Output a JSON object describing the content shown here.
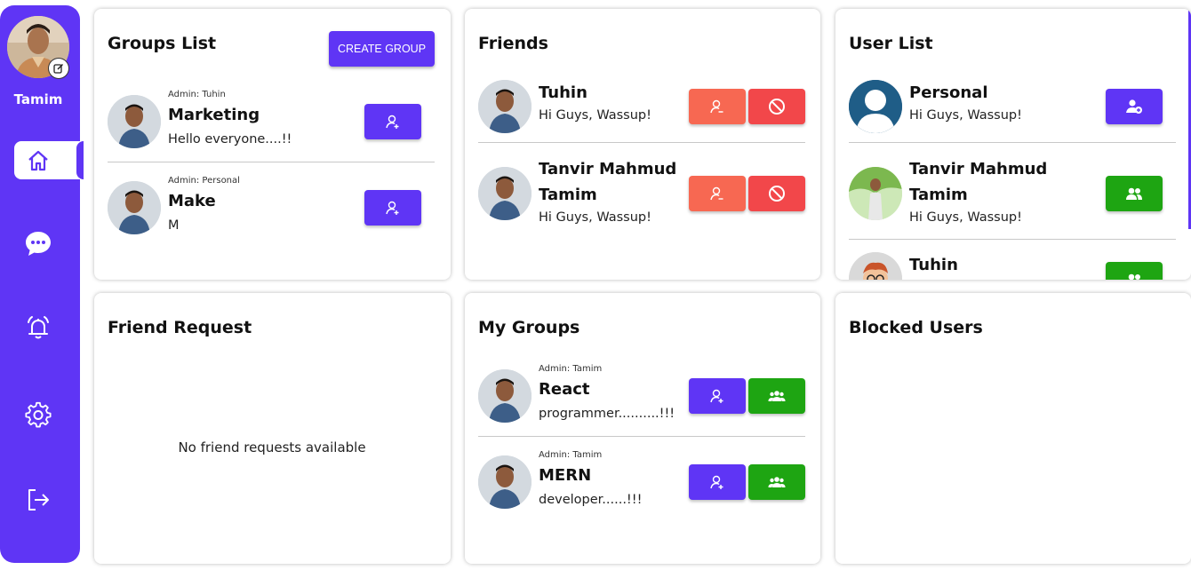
{
  "profile": {
    "name": "Tamim"
  },
  "nav": [
    {
      "icon": "home-icon"
    },
    {
      "icon": "chat-icon"
    },
    {
      "icon": "bell-icon"
    },
    {
      "icon": "gear-icon"
    },
    {
      "icon": "logout-icon"
    }
  ],
  "groups_list": {
    "title": "Groups List",
    "create_label": "CREATE GROUP",
    "items": [
      {
        "admin": "Admin: Tuhin",
        "name": "Marketing",
        "msg": "Hello everyone....!!"
      },
      {
        "admin": "Admin: Personal",
        "name": "Make",
        "msg": "M"
      }
    ]
  },
  "friends": {
    "title": "Friends",
    "items": [
      {
        "name": "Tuhin",
        "msg": "Hi Guys, Wassup!"
      },
      {
        "name_line1": "Tanvir Mahmud",
        "name_line2": "Tamim",
        "msg": "Hi Guys, Wassup!"
      }
    ]
  },
  "user_list": {
    "title": "User List",
    "items": [
      {
        "name": "Personal",
        "msg": "Hi Guys, Wassup!"
      },
      {
        "name_line1": "Tanvir Mahmud",
        "name_line2": "Tamim",
        "msg": "Hi Guys, Wassup!"
      },
      {
        "name": "Tuhin"
      }
    ]
  },
  "friend_request": {
    "title": "Friend Request",
    "empty": "No friend requests available"
  },
  "my_groups": {
    "title": "My Groups",
    "items": [
      {
        "admin": "Admin: Tamim",
        "name": "React",
        "msg": "programmer..........!!!"
      },
      {
        "admin": "Admin: Tamim",
        "name": "MERN",
        "msg": "developer......!!!"
      }
    ]
  },
  "blocked_users": {
    "title": "Blocked Users"
  },
  "colors": {
    "primary": "#5f35f5",
    "green": "#1ea512",
    "orange": "#f76852",
    "red": "#f2474a"
  }
}
